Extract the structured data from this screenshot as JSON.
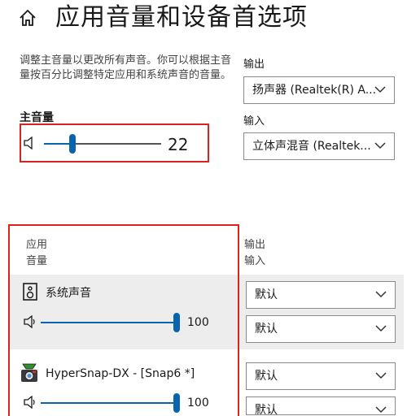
{
  "header": {
    "title": "应用音量和设备首选项",
    "home_icon": "home-icon"
  },
  "master": {
    "description": "调整主音量以更改所有声音。你可以根据主音量按百分比调整特定应用和系统声音的音量。",
    "label": "主音量",
    "value": 22,
    "value_text": "22"
  },
  "output": {
    "label": "输出",
    "value": "扬声器 (Realtek(R) A..."
  },
  "input": {
    "label": "输入",
    "value": "立体声混音 (Realtek..."
  },
  "apps_header": {
    "app_label": "应用",
    "volume_label": "音量",
    "output_label": "输出",
    "input_label": "输入"
  },
  "apps": [
    {
      "name": "系统声音",
      "volume": 100,
      "volume_text": "100",
      "output": "默认",
      "input": "默认"
    },
    {
      "name": "HyperSnap-DX - [Snap6 *]",
      "volume": 100,
      "volume_text": "100",
      "output": "默认",
      "input": "默认"
    }
  ],
  "colors": {
    "accent": "#0a64ad",
    "highlight_border": "#d9231f",
    "row_selected": "#ededed"
  }
}
